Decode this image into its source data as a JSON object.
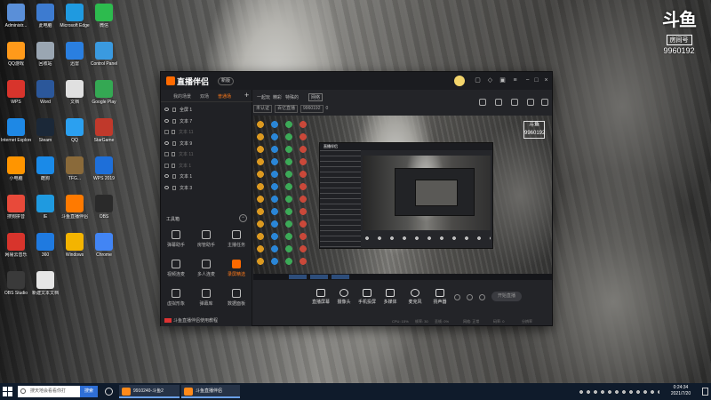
{
  "desktop": {
    "icons": [
      {
        "label": "Administr...",
        "icon": "folder-icon",
        "color": "#5a8fd8"
      },
      {
        "label": "此电脑",
        "icon": "computer-icon",
        "color": "#3d7bd0"
      },
      {
        "label": "Microsoft Edge",
        "icon": "edge-icon",
        "color": "#1f9ae0"
      },
      {
        "label": "微信",
        "icon": "wechat-icon",
        "color": "#2dbb4e"
      },
      {
        "label": "QQ游戏",
        "icon": "qq-game-icon",
        "color": "#ff9a1a"
      },
      {
        "label": "回收站",
        "icon": "recycle-bin-icon",
        "color": "#9aa6b2"
      },
      {
        "label": "迅雷",
        "icon": "xunlei-icon",
        "color": "#2a7fe0"
      },
      {
        "label": "Control Panel",
        "icon": "control-panel-icon",
        "color": "#3a9ae0"
      },
      {
        "label": "WPS",
        "icon": "wps-icon",
        "color": "#d8342c"
      },
      {
        "label": "Word",
        "icon": "word-icon",
        "color": "#2b579a"
      },
      {
        "label": "文档",
        "icon": "document-icon",
        "color": "#e0e0e0"
      },
      {
        "label": "Google Play",
        "icon": "play-icon",
        "color": "#34a853"
      },
      {
        "label": "Internet Explorer",
        "icon": "ie-icon",
        "color": "#1e88e5"
      },
      {
        "label": "Steam",
        "icon": "steam-icon",
        "color": "#1b2838"
      },
      {
        "label": "QQ",
        "icon": "qq-icon",
        "color": "#2ba0f0"
      },
      {
        "label": "StarGame",
        "icon": "star-game-icon",
        "color": "#c0392b"
      },
      {
        "label": "小电脑",
        "icon": "monitor-icon",
        "color": "#ff9500"
      },
      {
        "label": "酷狗",
        "icon": "kugou-icon",
        "color": "#1a8ae8"
      },
      {
        "label": "TFG...",
        "icon": "game-icon",
        "color": "#8a6a3a"
      },
      {
        "label": "WPS 2019",
        "icon": "wps-office-icon",
        "color": "#1e6fd9"
      },
      {
        "label": "搜狗拼音",
        "icon": "sogou-icon",
        "color": "#e84a3a"
      },
      {
        "label": "IE",
        "icon": "ie2-icon",
        "color": "#1f9ae0"
      },
      {
        "label": "斗鱼直播伴侣",
        "icon": "douyu-icon",
        "color": "#ff7a00"
      },
      {
        "label": "OBS",
        "icon": "obs-icon",
        "color": "#2a2a2a"
      },
      {
        "label": "网易云音乐",
        "icon": "netease-music-icon",
        "color": "#d8342c"
      },
      {
        "label": "360",
        "icon": "shield-icon",
        "color": "#1f7ae0"
      },
      {
        "label": "Windows",
        "icon": "windows-icon",
        "color": "#f4b400"
      },
      {
        "label": "Chrome",
        "icon": "chrome-icon",
        "color": "#4285f4"
      },
      {
        "label": "OBS Studio",
        "icon": "obs-studio-icon",
        "color": "#3a3a3a"
      },
      {
        "label": "新建文本文档",
        "icon": "text-file-icon",
        "color": "#e6e6e6"
      }
    ]
  },
  "badge": {
    "logo": "斗鱼",
    "sub": "房间号",
    "room_id": "9960192"
  },
  "app": {
    "title": "直播伴侣",
    "version": "新版",
    "left_tabs": [
      "我的场景",
      "双场",
      "普通场"
    ],
    "sources": [
      {
        "label": "全屏 1",
        "dim": false
      },
      {
        "label": "文本 7",
        "dim": false
      },
      {
        "label": "文本 11",
        "dim": true
      },
      {
        "label": "文本 9",
        "dim": false
      },
      {
        "label": "文本 11",
        "dim": true
      },
      {
        "label": "文本 1",
        "dim": true
      },
      {
        "label": "文本 1",
        "dim": false
      },
      {
        "label": "文本 3",
        "dim": false
      }
    ],
    "toolbox_label": "工具箱",
    "toolbox_toggle": "−",
    "tools": [
      {
        "label": "弹幕助手",
        "active": false
      },
      {
        "label": "房管助手",
        "active": false
      },
      {
        "label": "主播任务",
        "active": false
      },
      {
        "label": "视频连麦",
        "active": false
      },
      {
        "label": "多人连麦",
        "active": false
      },
      {
        "label": "录屏精选",
        "active": true
      },
      {
        "label": "虚拟形象",
        "active": false
      },
      {
        "label": "弹幕库",
        "active": false
      },
      {
        "label": "数据面板",
        "active": false
      }
    ],
    "left_footer": "斗鱼直播伴侣使用教程",
    "main_tabs": [
      "一起玩",
      "精彩",
      "特殊的",
      "网络"
    ],
    "room_tags": [
      "未认证",
      "百亿直播",
      "9960192"
    ],
    "room_like": "0",
    "controls": [
      "直播屏幕",
      "摄像头",
      "手机投屏",
      "多媒体",
      "麦克风",
      "扬声器"
    ],
    "live_button": "开始直播",
    "status": [
      "CPU: 15%",
      "帧率: 30",
      "丢帧: 0%",
      "网络: 正常",
      "码率: 0",
      "分辨率"
    ]
  },
  "taskbar": {
    "search_placeholder": "搜天地会看看你打",
    "search_button": "搜索",
    "tasks": [
      {
        "label": "9910240-斗鱼2"
      },
      {
        "label": "斗鱼直播伴侣"
      }
    ],
    "time": "0:24:34",
    "date": "2021/7/20"
  }
}
